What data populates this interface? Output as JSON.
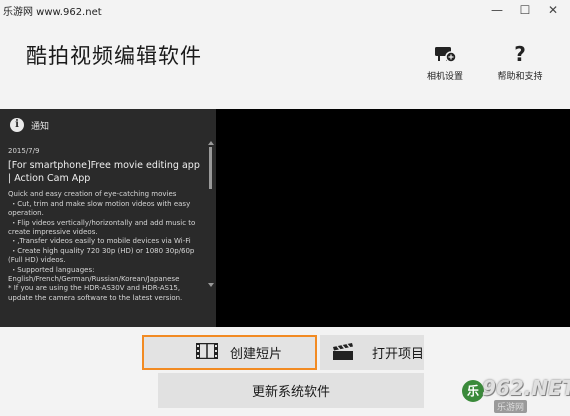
{
  "window": {
    "site_label": "乐游网 www.962.net",
    "minimize_glyph": "—",
    "maximize_glyph": "☐",
    "close_glyph": "✕"
  },
  "app": {
    "title": "酷拍视频编辑软件"
  },
  "toolbar": {
    "camera_settings_label": "相机设置",
    "camera_icon": "camera-settings-icon",
    "help_label": "帮助和支持",
    "help_glyph": "?"
  },
  "notice": {
    "header_label": "通知",
    "info_glyph": "i",
    "date": "2015/7/9",
    "title": "[For smartphone]Free movie editing app | Action Cam App",
    "lines": [
      "Quick and easy creation of eye-catching movies",
      " ・Cut, trim and make slow motion videos with easy operation.",
      " ・Flip videos vertically/horizontally and add music to create impressive videos.",
      " ・,Transfer videos easily to mobile devices via Wi-Fi",
      " ・Create high quality 720 30p (HD) or 1080 30p/60p (Full HD) videos.",
      " ・Supported languages:",
      "English/French/German/Russian/Korean/Japanese",
      "* If you are using the HDR-AS30V and HDR-AS15, update the camera software to the latest version."
    ]
  },
  "actions": {
    "create_label": "创建短片",
    "open_label": "打开项目",
    "update_label": "更新系统软件"
  },
  "watermark": {
    "brand": "962.NET",
    "sub": "乐游网",
    "badge": "乐"
  },
  "colors": {
    "highlight_border": "#f28b23",
    "notice_bg": "#2a2a2a",
    "preview_bg": "#000000"
  }
}
